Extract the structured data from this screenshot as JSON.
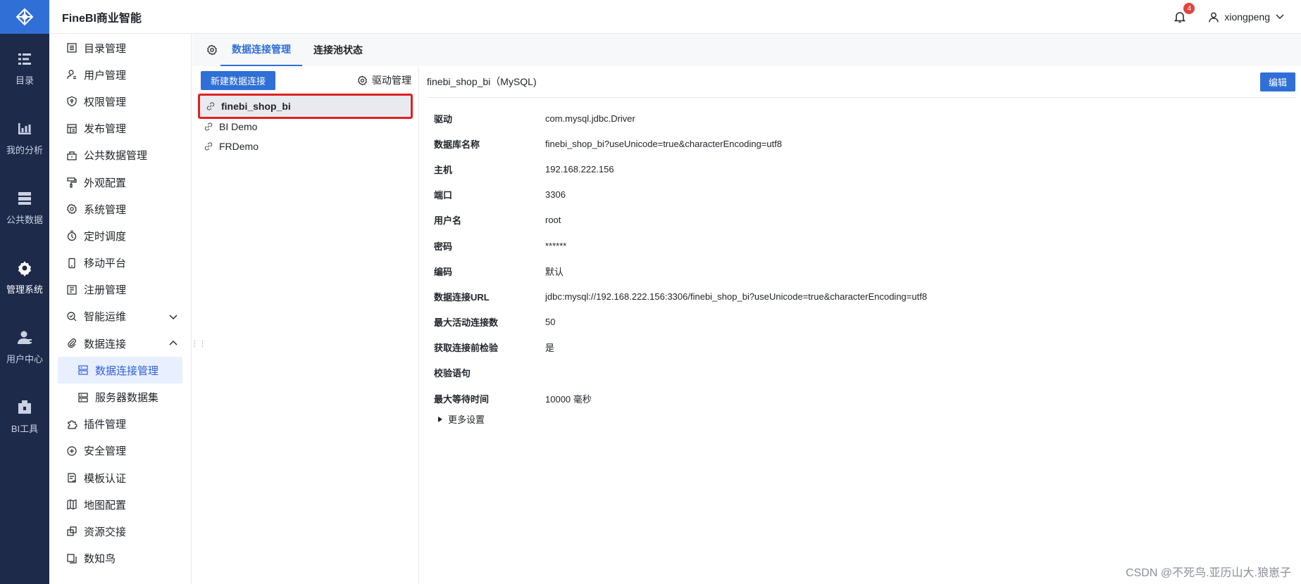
{
  "header": {
    "app_title": "FineBI商业智能",
    "notification_count": "4",
    "username": "xiongpeng"
  },
  "rail": {
    "items": [
      {
        "label": "目录",
        "icon": "catalog-icon"
      },
      {
        "label": "我的分析",
        "icon": "analysis-icon"
      },
      {
        "label": "公共数据",
        "icon": "public-data-icon"
      },
      {
        "label": "管理系统",
        "icon": "gear-icon",
        "active": true
      },
      {
        "label": "用户中心",
        "icon": "user-center-icon"
      },
      {
        "label": "BI工具",
        "icon": "toolbox-icon"
      }
    ]
  },
  "menu": {
    "items": [
      {
        "label": "目录管理"
      },
      {
        "label": "用户管理"
      },
      {
        "label": "权限管理"
      },
      {
        "label": "发布管理"
      },
      {
        "label": "公共数据管理"
      },
      {
        "label": "外观配置"
      },
      {
        "label": "系统管理"
      },
      {
        "label": "定时调度"
      },
      {
        "label": "移动平台"
      },
      {
        "label": "注册管理"
      },
      {
        "label": "智能运维"
      },
      {
        "label": "数据连接"
      },
      {
        "label": "数据连接管理"
      },
      {
        "label": "服务器数据集"
      },
      {
        "label": "插件管理"
      },
      {
        "label": "安全管理"
      },
      {
        "label": "模板认证"
      },
      {
        "label": "地图配置"
      },
      {
        "label": "资源交接"
      },
      {
        "label": "数知鸟"
      }
    ]
  },
  "tabs": {
    "items": [
      {
        "label": "数据连接管理"
      },
      {
        "label": "连接池状态"
      }
    ]
  },
  "connections": {
    "new_button": "新建数据连接",
    "driver_button": "驱动管理",
    "items": [
      {
        "name": "finebi_shop_bi"
      },
      {
        "name": "BI Demo"
      },
      {
        "name": "FRDemo"
      }
    ]
  },
  "detail": {
    "title": "finebi_shop_bi（MySQL)",
    "edit_button": "编辑",
    "fields": [
      {
        "key": "驱动",
        "value": "com.mysql.jdbc.Driver"
      },
      {
        "key": "数据库名称",
        "value": "finebi_shop_bi?useUnicode=true&characterEncoding=utf8"
      },
      {
        "key": "主机",
        "value": "192.168.222.156"
      },
      {
        "key": "端口",
        "value": "3306"
      },
      {
        "key": "用户名",
        "value": "root"
      },
      {
        "key": "密码",
        "value": "******"
      },
      {
        "key": "编码",
        "value": "默认"
      },
      {
        "key": "数据连接URL",
        "value": "jdbc:mysql://192.168.222.156:3306/finebi_shop_bi?useUnicode=true&characterEncoding=utf8"
      },
      {
        "key": "最大活动连接数",
        "value": "50"
      },
      {
        "key": "获取连接前检验",
        "value": "是"
      },
      {
        "key": "校验语句",
        "value": ""
      },
      {
        "key": "最大等待时间",
        "value": "10000 毫秒"
      }
    ],
    "more_settings": "更多设置"
  },
  "watermark": "CSDN @不死鸟.亚历山大.狼崽子",
  "colors": {
    "accent": "#2f6fd6",
    "rail_bg": "#1e2a4a",
    "highlight_border": "#e02020"
  }
}
